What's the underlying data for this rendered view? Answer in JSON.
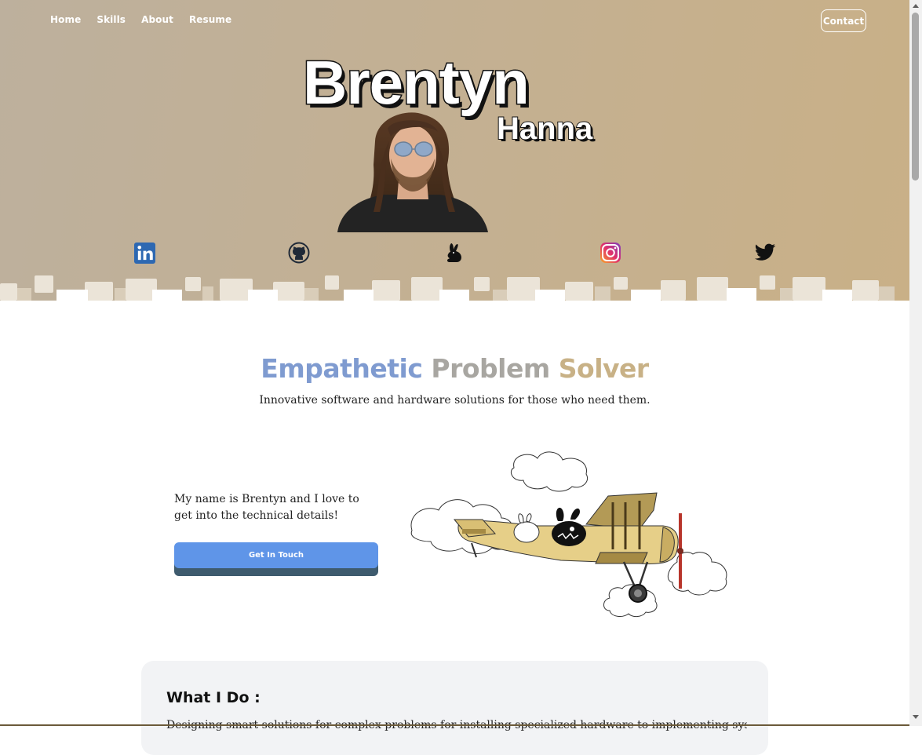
{
  "nav": {
    "items": [
      {
        "label": "Home"
      },
      {
        "label": "Skills"
      },
      {
        "label": "About"
      },
      {
        "label": "Resume"
      }
    ],
    "contact_label": "Contact"
  },
  "hero": {
    "first_name": "Brentyn",
    "last_name": "Hanna",
    "socials": [
      {
        "icon": "linkedin-icon",
        "color": "#2d68b2"
      },
      {
        "icon": "github-icon",
        "color": "#1f2937"
      },
      {
        "icon": "rabbit-icon",
        "color": "#111111"
      },
      {
        "icon": "instagram-icon",
        "color": "#e1306c"
      },
      {
        "icon": "twitter-icon",
        "color": "#111111"
      }
    ]
  },
  "main": {
    "headline_words": [
      "Empathetic",
      "Problem",
      "Solver"
    ],
    "subline": "Innovative software and hardware solutions for those who need them.",
    "intro": "My name is Brentyn and I love to get into the technical details!",
    "cta_label": "Get In Touch"
  },
  "what_i_do": {
    "title": "What I Do :",
    "text_partial": "Designing smart solutions for complex problems for installing specialized hardware to implementing systems"
  },
  "colors": {
    "accent_blue": "#7f9bd0",
    "accent_tan": "#c8b186",
    "button_blue": "#5f95e8",
    "hero_bg": "#c4b091"
  }
}
